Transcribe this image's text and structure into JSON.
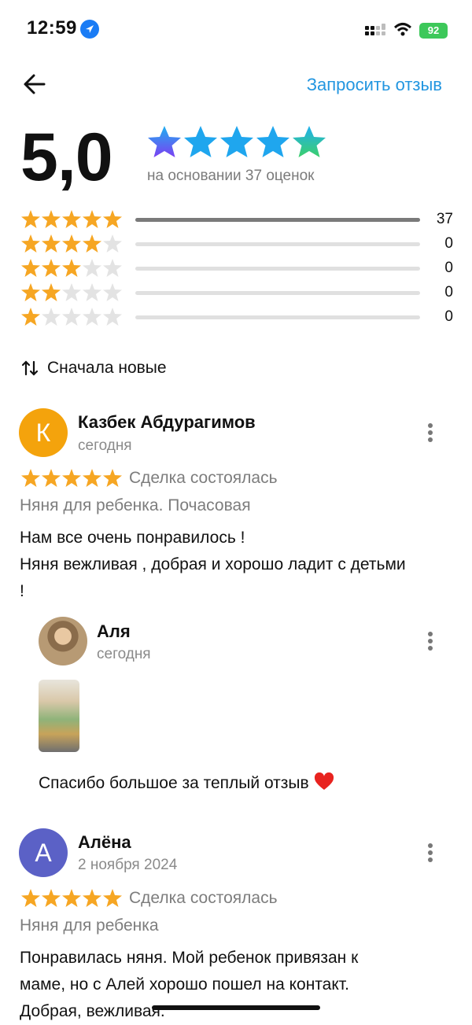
{
  "status_bar": {
    "time": "12:59",
    "battery": "92"
  },
  "header": {
    "request_review": "Запросить отзыв"
  },
  "summary": {
    "score": "5,0",
    "based_on": "на основании 37 оценок"
  },
  "histogram": [
    {
      "stars": 5,
      "count": "37",
      "fraction": 1.0
    },
    {
      "stars": 4,
      "count": "0",
      "fraction": 0
    },
    {
      "stars": 3,
      "count": "0",
      "fraction": 0
    },
    {
      "stars": 2,
      "count": "0",
      "fraction": 0
    },
    {
      "stars": 1,
      "count": "0",
      "fraction": 0
    }
  ],
  "sort": {
    "label": "Сначала новые"
  },
  "reviews": [
    {
      "initial": "К",
      "avatar_color": "#f4a30c",
      "name": "Казбек Абдурагимов",
      "date": "сегодня",
      "rating": 5,
      "status": "Сделка состоялась",
      "category": "Няня для ребенка. Почасовая",
      "text_lines": [
        "Нам все очень понравилось !",
        "Няня вежливая , добрая и хорошо ладит с детьми",
        "!"
      ],
      "reply": {
        "name": "Аля",
        "date": "сегодня",
        "text": "Спасибо большое за теплый отзыв"
      }
    },
    {
      "initial": "А",
      "avatar_color": "#5b61c6",
      "name": "Алёна",
      "date": "2 ноября 2024",
      "rating": 5,
      "status": "Сделка состоялась",
      "category": "Няня для ребенка",
      "text_lines": [
        "Понравилась няня. Мой ребенок привязан к",
        "маме, но с Алей хорошо пошел на контакт.",
        "Добрая, вежливая."
      ]
    }
  ],
  "colors": {
    "accent": "#2396e0",
    "star": "#f6a623",
    "star_empty": "#e3e3e3"
  }
}
